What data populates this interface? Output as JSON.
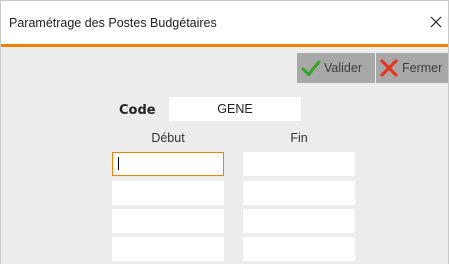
{
  "window": {
    "title": "Paramétrage des Postes Budgétaires",
    "accent_color": "#f08200"
  },
  "toolbar": {
    "valider_label": "Valider",
    "fermer_label": "Fermer",
    "valider_icon": "check-icon",
    "fermer_icon": "close-x-icon"
  },
  "form": {
    "code_label": "Code",
    "code_value": "GENE",
    "columns": {
      "debut": "Début",
      "fin": "Fin"
    },
    "rows": [
      {
        "debut": "",
        "fin": ""
      },
      {
        "debut": "",
        "fin": ""
      },
      {
        "debut": "",
        "fin": ""
      },
      {
        "debut": "",
        "fin": ""
      }
    ]
  }
}
